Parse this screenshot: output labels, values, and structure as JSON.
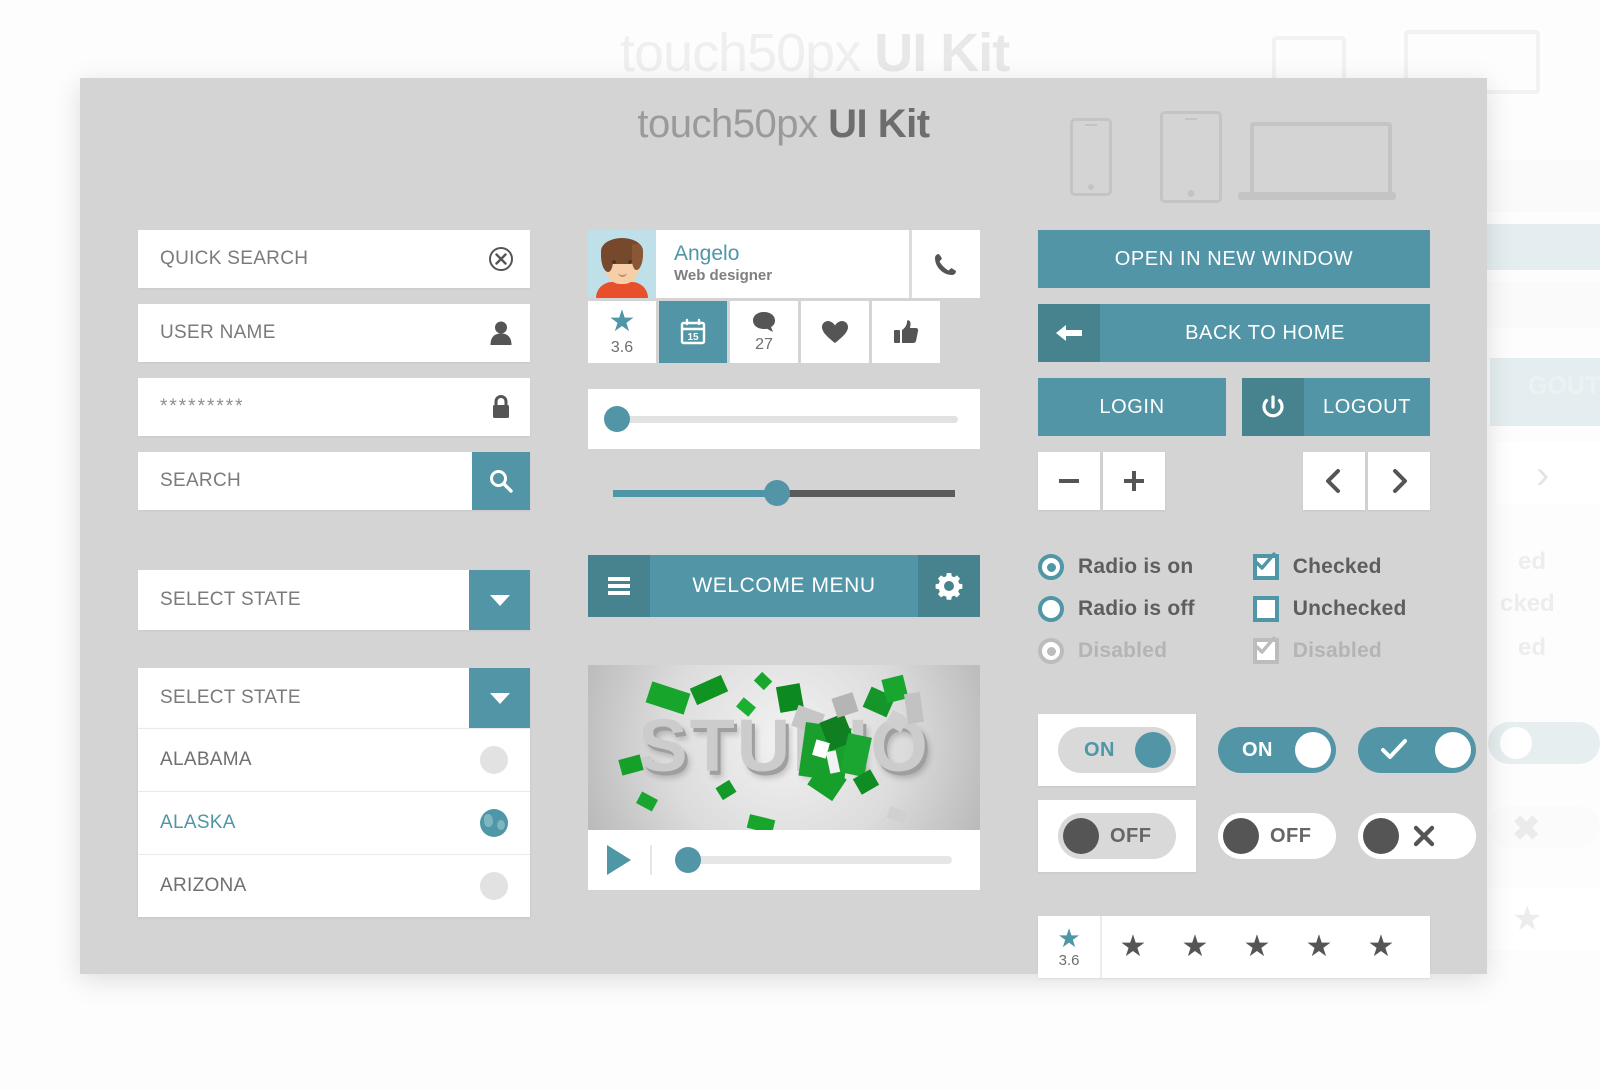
{
  "header": {
    "title_light": "touch50px",
    "title_bold": "UI Kit",
    "devices": [
      "phone-icon",
      "tablet-icon",
      "laptop-icon"
    ]
  },
  "colors": {
    "teal": "#5295a6",
    "teal_dark": "#47838f",
    "panel_bg": "#d4d4d4",
    "field_bg": "#ffffff",
    "text_gray": "#7b7b7b",
    "icon_dark": "#555555"
  },
  "left_column": {
    "fields": [
      {
        "label": "QUICK SEARCH",
        "icon": "clear-circle-icon",
        "icon_style": "plain",
        "value": ""
      },
      {
        "label": "USER NAME",
        "icon": "user-icon",
        "icon_style": "plain",
        "value": ""
      },
      {
        "label": "*********",
        "icon": "lock-icon",
        "icon_style": "plain",
        "value": "*********"
      },
      {
        "label": "SEARCH",
        "icon": "search-icon",
        "icon_style": "teal",
        "value": ""
      }
    ],
    "dropdown_closed": {
      "label": "SELECT STATE",
      "icon": "chevron-down-icon"
    },
    "dropdown_open": {
      "label": "SELECT STATE",
      "icon": "chevron-down-icon",
      "options": [
        {
          "name": "ALABAMA",
          "selected": false
        },
        {
          "name": "ALASKA",
          "selected": true
        },
        {
          "name": "ARIZONA",
          "selected": false
        }
      ]
    }
  },
  "middle_column": {
    "profile": {
      "name": "Angelo",
      "role": "Web designer",
      "avatar": "avatar-icon",
      "call_icon": "phone-icon"
    },
    "actions": [
      {
        "icon": "star-icon",
        "value": "3.6",
        "active": false
      },
      {
        "icon": "calendar-icon",
        "value": "15",
        "active": true
      },
      {
        "icon": "comment-icon",
        "value": "27",
        "active": false
      },
      {
        "icon": "heart-icon",
        "value": "",
        "active": false
      },
      {
        "icon": "thumbs-up-icon",
        "value": "",
        "active": false
      }
    ],
    "slider_card": {
      "value": 2,
      "min": 0,
      "max": 100
    },
    "slider_bare": {
      "value": 48,
      "min": 0,
      "max": 100
    },
    "welcome_menu": {
      "label": "WELCOME MENU",
      "left_icon": "hamburger-icon",
      "right_icon": "gear-icon"
    },
    "video": {
      "title": "STUDIO",
      "play_icon": "play-icon",
      "progress": 3
    }
  },
  "right_column": {
    "buttons": [
      {
        "label": "OPEN IN NEW WINDOW",
        "icon": ""
      },
      {
        "label": "BACK TO HOME",
        "icon": "back-arrow-icon"
      }
    ],
    "login_label": "LOGIN",
    "logout_label": "LOGOUT",
    "logout_icon": "power-icon",
    "steppers": [
      "minus-icon",
      "plus-icon"
    ],
    "pagers": [
      "chevron-left-icon",
      "chevron-right-icon"
    ],
    "radios": [
      {
        "label": "Radio is on",
        "state": "on"
      },
      {
        "label": "Radio is off",
        "state": "off"
      },
      {
        "label": "Disabled",
        "state": "disabled"
      }
    ],
    "checkboxes": [
      {
        "label": "Checked",
        "state": "checked"
      },
      {
        "label": "Unchecked",
        "state": "unchecked"
      },
      {
        "label": "Disabled",
        "state": "disabled"
      }
    ],
    "toggles": [
      {
        "label": "ON",
        "state": "on",
        "style": "boxed-plain"
      },
      {
        "label": "ON",
        "state": "on",
        "style": "teal"
      },
      {
        "label": "check-icon",
        "state": "on",
        "style": "teal-icon"
      },
      {
        "label": "OFF",
        "state": "off",
        "style": "boxed-plain"
      },
      {
        "label": "OFF",
        "state": "off",
        "style": "white"
      },
      {
        "label": "close-icon",
        "state": "off",
        "style": "white-icon"
      }
    ],
    "rating": {
      "value": "3.6",
      "stars": 5,
      "filled": 1
    }
  },
  "background_ghost": {
    "title_light": "touch50px",
    "title_bold": "UI Kit",
    "fragments": [
      "GOUT",
      "ed",
      "cked",
      "ed"
    ]
  }
}
